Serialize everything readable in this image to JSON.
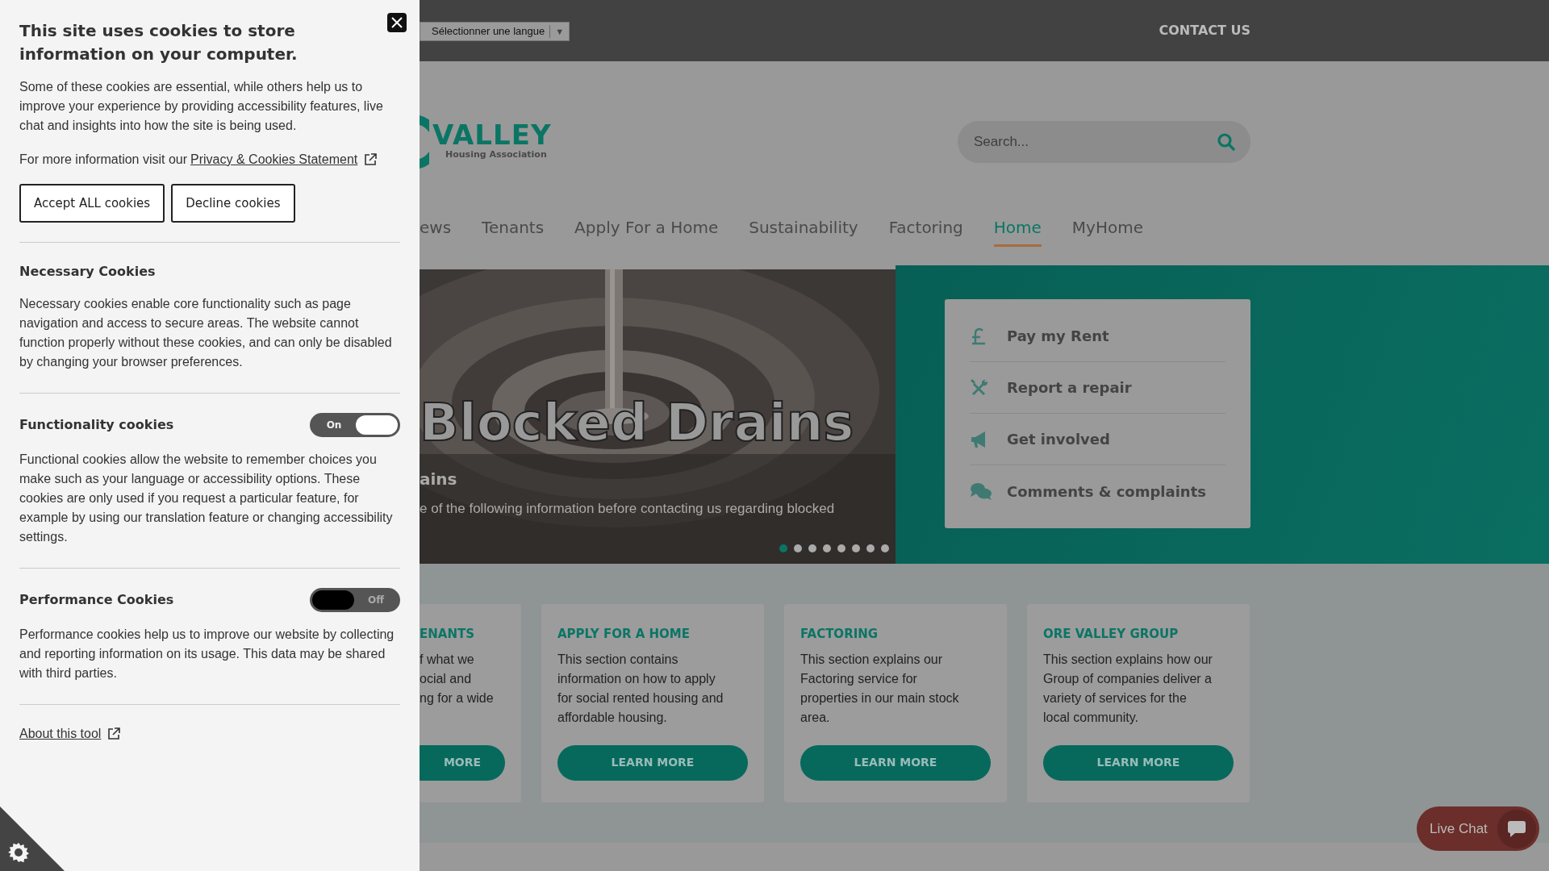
{
  "cookie_panel": {
    "title": "This site uses cookies to store information on your computer.",
    "intro": "Some of these cookies are essential, while others help us to improve your experience by providing accessibility features, live chat and insights into how the site is being used.",
    "more_info": {
      "text": "For more information visit our",
      "link": "Privacy & Cookies Statement"
    },
    "buttons": [
      "Accept ALL cookies",
      "Decline cookies"
    ],
    "sections": [
      {
        "kind": "plain",
        "title": "Necessary Cookies",
        "description": "Necessary cookies enable core functionality such as page navigation and access to secure areas. The website cannot function properly without these cookies, and can only be disabled by changing your browser preferences."
      },
      {
        "kind": "toggle",
        "title": "Functionality cookies",
        "on": true,
        "toggle_label": "On",
        "description": "Functional cookies allow the website to remember choices you make such as your language or accessibility options. These cookies are only used if you request a particular feature, for example by using our translation feature or changing accessibility settings."
      },
      {
        "kind": "toggle",
        "title": "Performance Cookies",
        "on": false,
        "toggle_label": "Off",
        "description": "Performance cookies help us to improve our website by collecting and reporting information on its usage. This data may be shared with third parties."
      }
    ],
    "about_link": "About this tool"
  },
  "top_bar": {
    "language_select": "Sélectionner une langue",
    "caret": "▼",
    "contact": "CONTACT US"
  },
  "logo": {
    "name": "VALLEY",
    "tagline": "Housing Association"
  },
  "search": {
    "placeholder": "Search..."
  },
  "nav": [
    {
      "label": "ews",
      "selected": false
    },
    {
      "label": "Tenants",
      "selected": false
    },
    {
      "label": "Apply For a Home",
      "selected": false
    },
    {
      "label": "Sustainability",
      "selected": false
    },
    {
      "label": "Factoring",
      "selected": false
    },
    {
      "label": "Home",
      "selected": true
    },
    {
      "label": "MyHome",
      "selected": false
    }
  ],
  "hero": {
    "headline": "Blocked Drains",
    "title": "ains",
    "text": "e of the following information before contacting us regarding blocked",
    "slides": [
      {
        "selected": true
      },
      {
        "selected": false
      },
      {
        "selected": false
      },
      {
        "selected": false
      },
      {
        "selected": false
      },
      {
        "selected": false
      },
      {
        "selected": false
      },
      {
        "selected": false
      }
    ]
  },
  "quick_links": [
    {
      "label": "Pay my Rent"
    },
    {
      "label": "Report a repair"
    },
    {
      "label": "Get involved"
    },
    {
      "label": "Comments & complaints"
    }
  ],
  "cards": [
    {
      "title": "ENANTS",
      "lines": [
        "f what we",
        "ocial and",
        "ng for a wide"
      ],
      "button": "MORE"
    },
    {
      "title": "APPLY FOR A HOME",
      "lines": [
        "This section contains",
        "information on how to apply",
        "for social rented housing and",
        "affordable housing."
      ],
      "button": "LEARN MORE"
    },
    {
      "title": "FACTORING",
      "lines": [
        "This section explains our",
        "Factoring service for",
        "properties in our main stock",
        "area."
      ],
      "button": "LEARN MORE"
    },
    {
      "title": "ORE VALLEY GROUP",
      "lines": [
        "This section explains how our",
        "Group of companies deliver a",
        "variety of services for the",
        "local community."
      ],
      "button": "LEARN MORE"
    }
  ],
  "live_chat": "Live Chat"
}
